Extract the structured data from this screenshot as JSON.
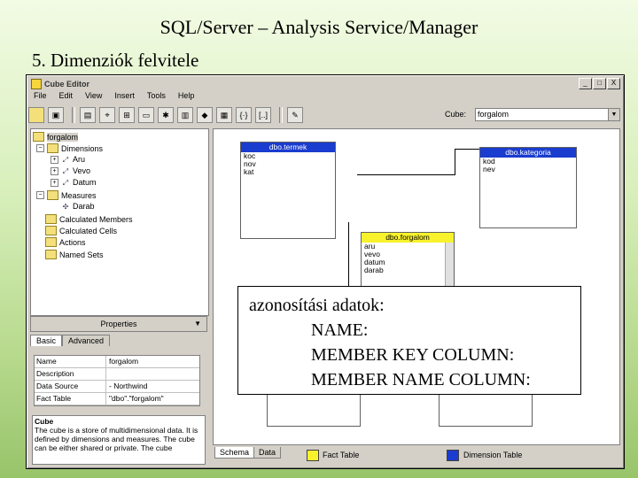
{
  "slide": {
    "title": "SQL/Server – Analysis Service/Manager",
    "subtitle": "5. Dimenziók felvitele"
  },
  "window": {
    "title": "Cube Editor",
    "controls": [
      "_",
      "□",
      "X"
    ],
    "menu": [
      "File",
      "Edit",
      "View",
      "Insert",
      "Tools",
      "Help"
    ],
    "cube_label": "Cube:",
    "cube_value": "forgalom"
  },
  "tree": {
    "root": "forgalom",
    "dimensions_label": "Dimensions",
    "dimensions": [
      "Aru",
      "Vevo",
      "Datum"
    ],
    "measures_label": "Measures",
    "measures": [
      "Darab"
    ],
    "other": [
      "Calculated Members",
      "Calculated Cells",
      "Actions",
      "Named Sets"
    ]
  },
  "properties": {
    "header": "Properties",
    "tabs": [
      "Basic",
      "Advanced"
    ],
    "rows": [
      {
        "key": "Name",
        "value": "forgalom"
      },
      {
        "key": "Description",
        "value": ""
      },
      {
        "key": "Data Source",
        "value": "- Northwind"
      },
      {
        "key": "Fact Table",
        "value": "\"dbo\".\"forgalom\""
      }
    ],
    "desc_title": "Cube",
    "desc_text": "The cube is a store of multidimensional data. It is defined by dimensions and measures. The cube can be either shared or private. The cube"
  },
  "schema": {
    "tables": [
      {
        "name": "dbo.termek",
        "type": "dimension",
        "columns": [
          "koc",
          "nov",
          "kat"
        ]
      },
      {
        "name": "dbo.kategoria",
        "type": "dimension",
        "columns": [
          "kod",
          "nev"
        ]
      },
      {
        "name": "dbo.forgalom",
        "type": "fact",
        "columns": [
          "aru",
          "vevo",
          "datum",
          "darab"
        ]
      }
    ],
    "tabs": [
      "Schema",
      "Data"
    ],
    "legend": [
      {
        "label": "Fact Table",
        "color": "#f7f22c"
      },
      {
        "label": "Dimension Table",
        "color": "#1a3ccf"
      }
    ]
  },
  "callout": {
    "line1": "azonosítási adatok:",
    "line2": "NAME:",
    "line3": "MEMBER KEY  COLUMN:",
    "line4": "MEMBER NAME COLUMN:"
  }
}
